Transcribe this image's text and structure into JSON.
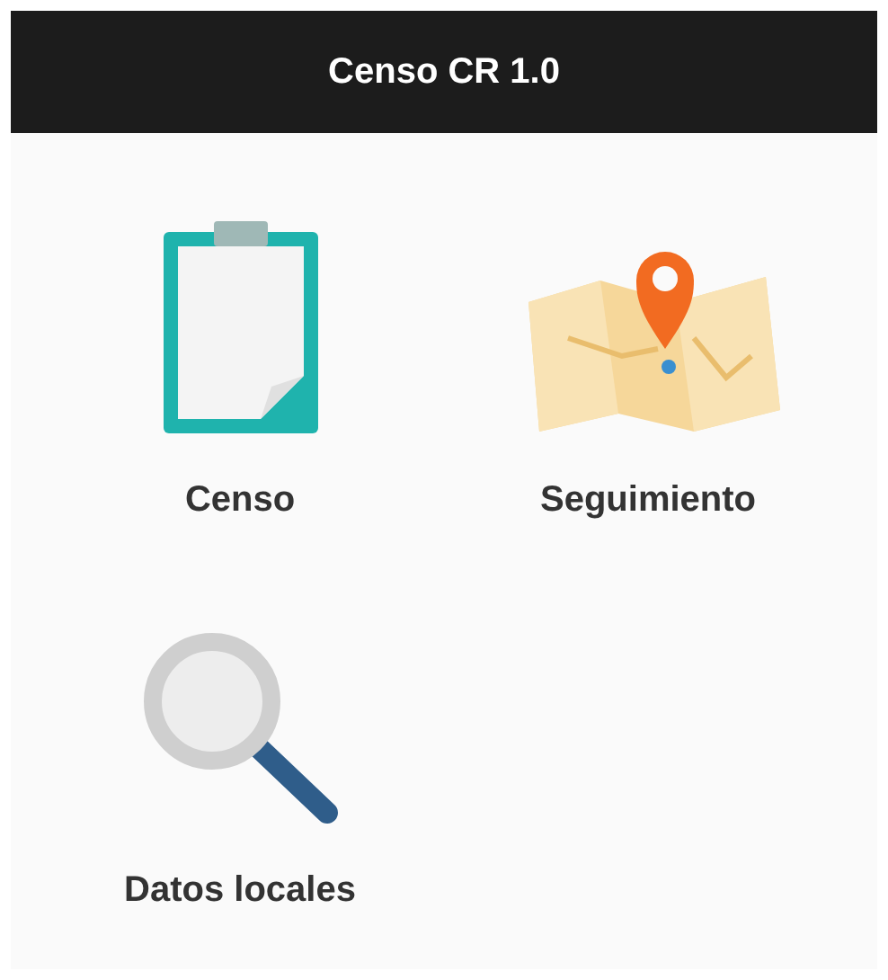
{
  "app_bar": {
    "title": "Censo CR 1.0"
  },
  "menu": [
    {
      "label": "Censo",
      "kind": "clipboard"
    },
    {
      "label": "Seguimiento",
      "kind": "map"
    },
    {
      "label": "Datos locales",
      "kind": "search"
    }
  ]
}
